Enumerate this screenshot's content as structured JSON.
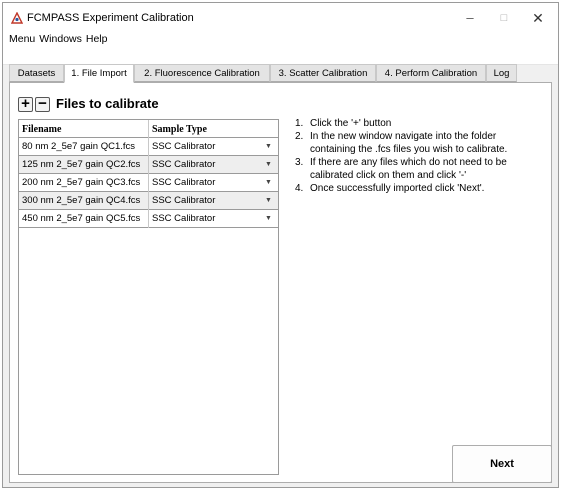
{
  "window": {
    "title": "FCMPASS Experiment Calibration",
    "minimize": "–",
    "maximize": "□",
    "close": "✕"
  },
  "menubar": {
    "items": [
      "Menu",
      "Windows",
      "Help"
    ]
  },
  "tabs": [
    {
      "label": "Datasets"
    },
    {
      "label": "1. File Import"
    },
    {
      "label": "2. Fluorescence Calibration"
    },
    {
      "label": "3. Scatter Calibration"
    },
    {
      "label": "4. Perform Calibration"
    },
    {
      "label": "Log"
    }
  ],
  "active_tab": "1. File Import",
  "files": {
    "add_label": "+",
    "remove_label": "−",
    "title": "Files to calibrate",
    "columns": [
      "Filename",
      "Sample Type"
    ],
    "rows": [
      {
        "filename": "80 nm 2_5e7 gain QC1.fcs",
        "sample_type": "SSC Calibrator"
      },
      {
        "filename": "125 nm 2_5e7 gain QC2.fcs",
        "sample_type": "SSC Calibrator"
      },
      {
        "filename": "200 nm 2_5e7 gain QC3.fcs",
        "sample_type": "SSC Calibrator"
      },
      {
        "filename": "300 nm 2_5e7 gain QC4.fcs",
        "sample_type": "SSC Calibrator"
      },
      {
        "filename": "450 nm 2_5e7 gain QC5.fcs",
        "sample_type": "SSC Calibrator"
      }
    ]
  },
  "instructions": [
    {
      "num": "1.",
      "text": "Click the '+' button"
    },
    {
      "num": "2.",
      "text": "In the new window navigate into the folder containing the .fcs files you wish to calibrate."
    },
    {
      "num": "3.",
      "text": "If there are any files which do not need to be calibrated click on them and click '-'"
    },
    {
      "num": "4.",
      "text": "Once successfully imported click 'Next'."
    }
  ],
  "next_label": "Next",
  "colors": {
    "accent": "#c0392b",
    "tab_inactive": "#e4e4e4",
    "row_alt": "#eeeeee"
  }
}
